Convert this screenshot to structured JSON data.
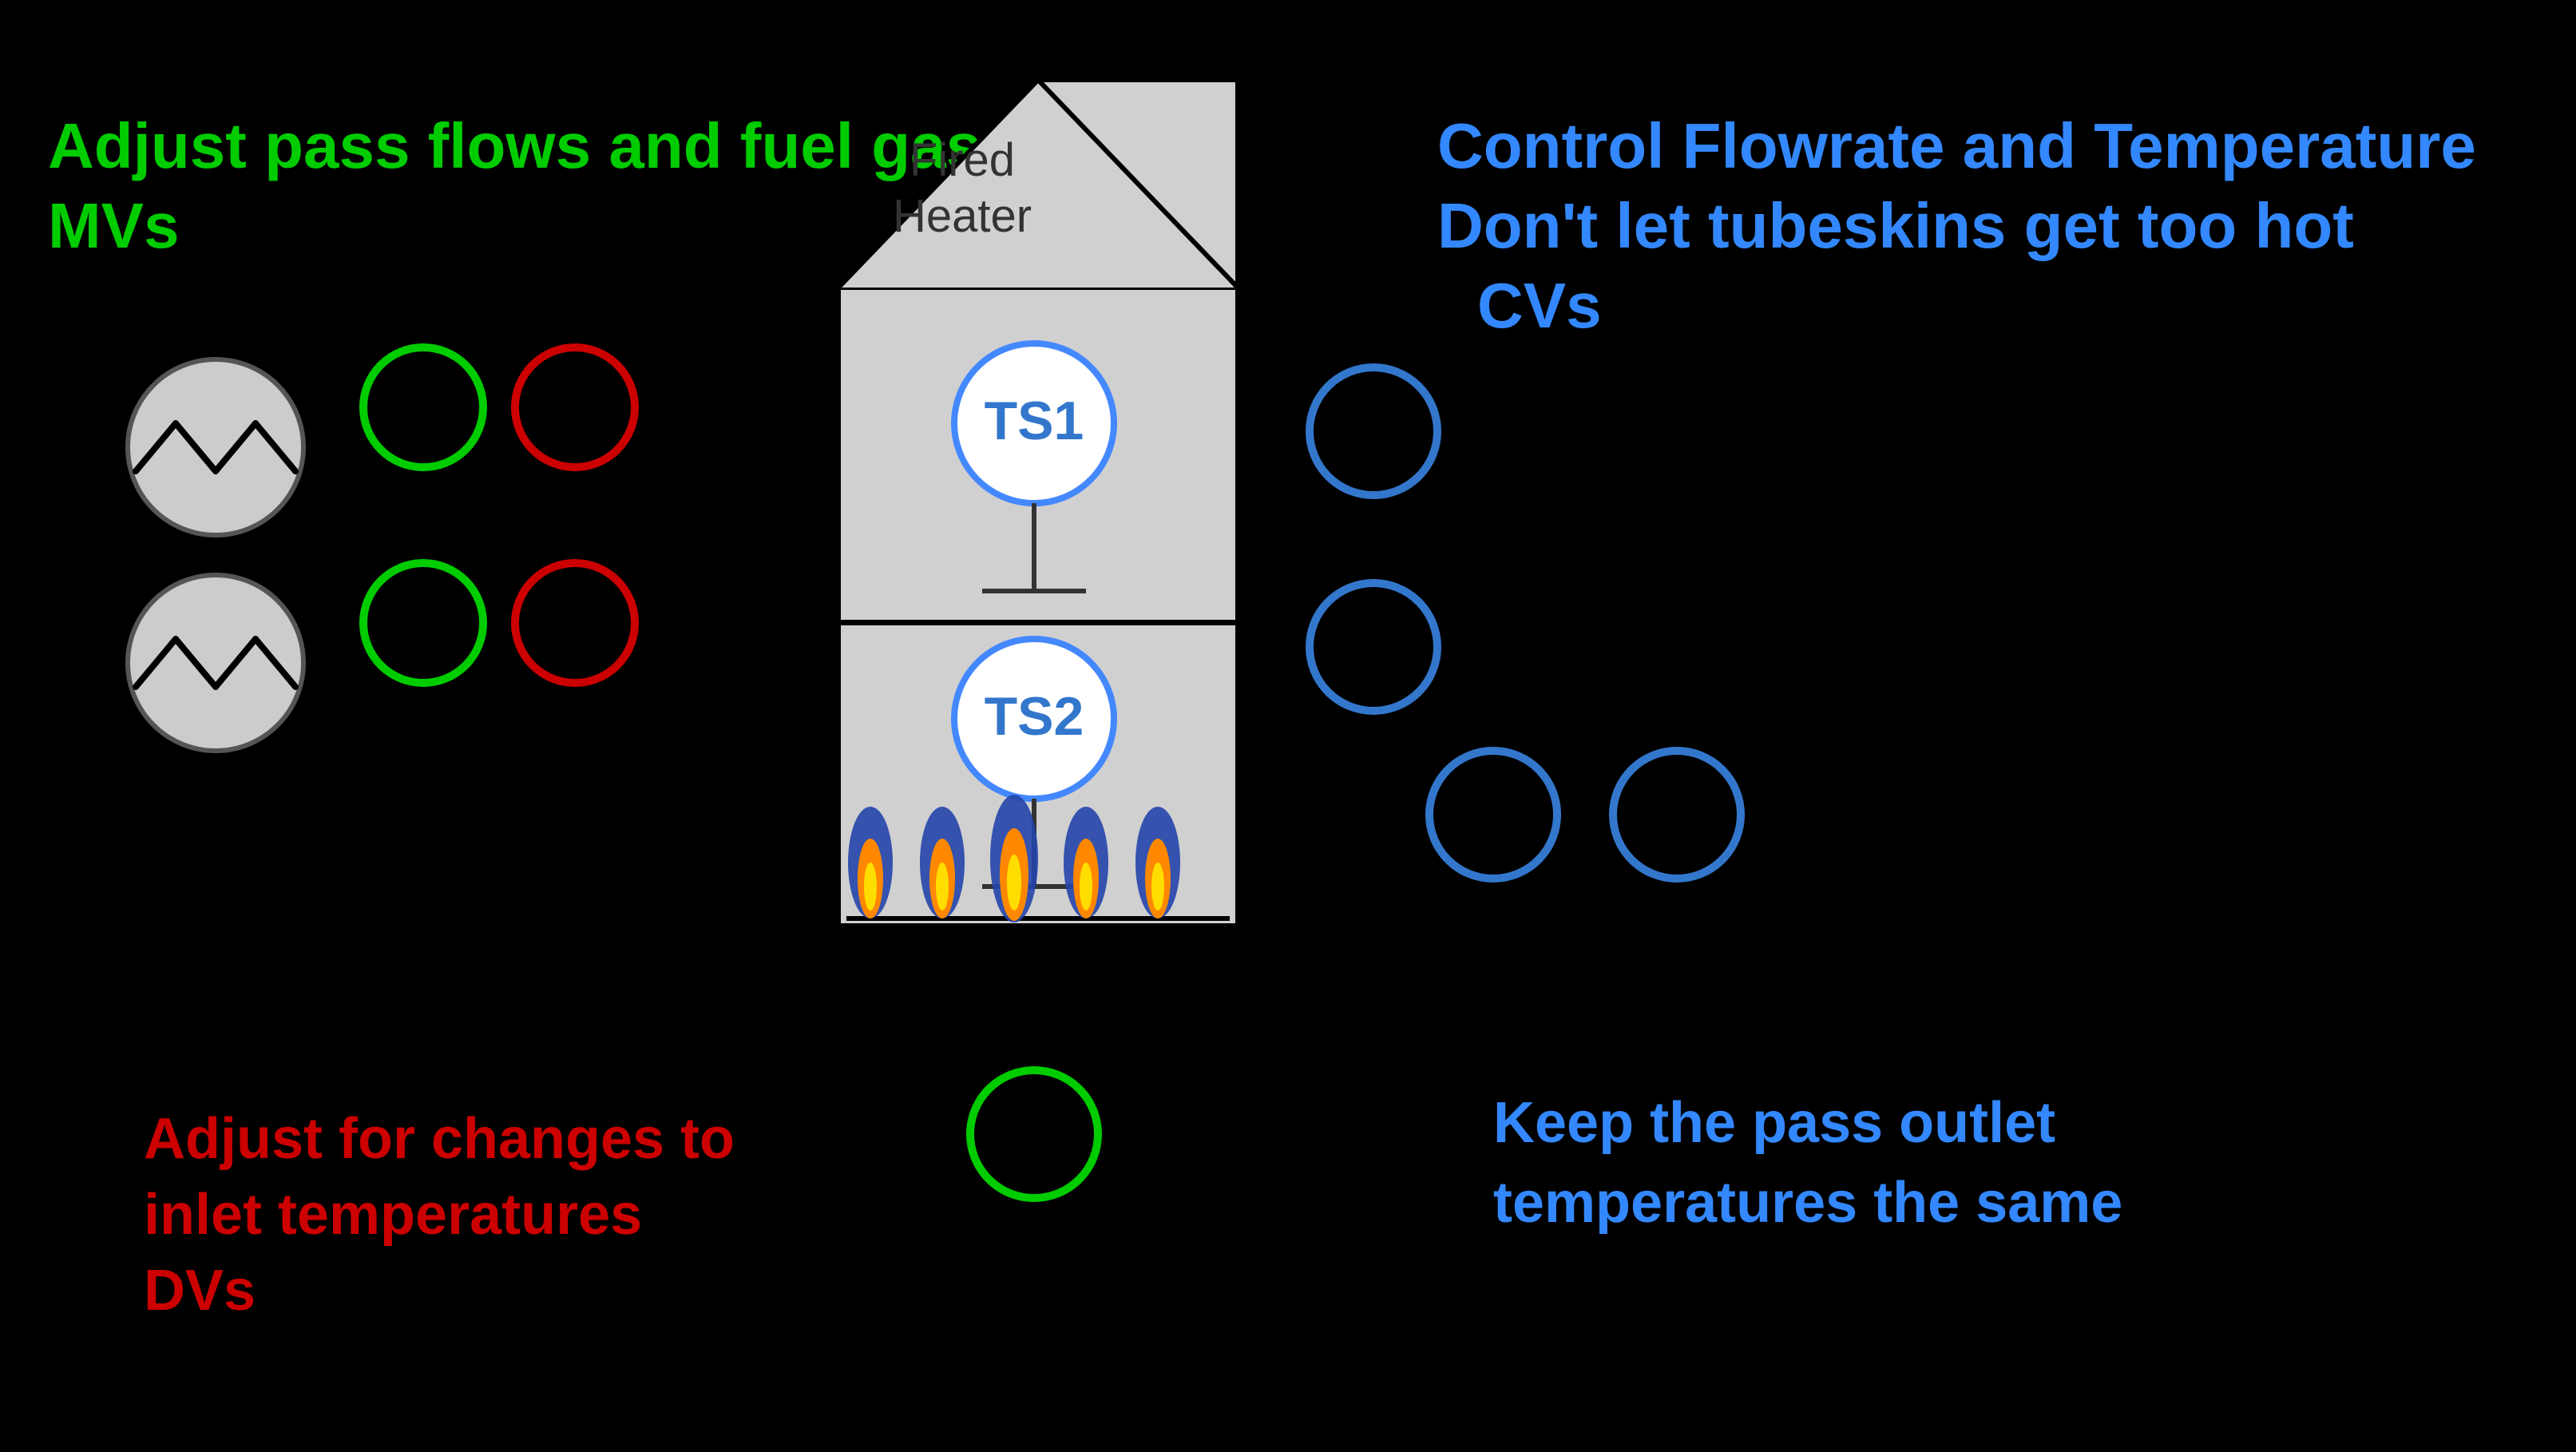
{
  "labels": {
    "mv_title": "Adjust pass flows and fuel gas",
    "mv_subtitle": "MVs",
    "cv_line1": "Control Flowrate and Temperature",
    "cv_line2": "Don't let tubeskins get too hot",
    "cv_subtitle": "CVs",
    "dv_line1": "Adjust for changes to",
    "dv_line2": "inlet temperatures",
    "dv_subtitle": "DVs",
    "pass_outlet_line1": "Keep the pass outlet",
    "pass_outlet_line2": "temperatures the same"
  },
  "colors": {
    "background": "#000000",
    "green": "#00cc00",
    "red": "#cc0000",
    "blue": "#3377cc",
    "heater_fill": "#d0d0d0",
    "heater_stroke": "#000000",
    "ts_circle_stroke": "#4488ff",
    "ts_circle_fill": "white",
    "flame_orange": "#ff8800",
    "flame_dark": "#cc4400",
    "burner_blue": "#2244aa"
  },
  "sensors": {
    "ts1_label": "TS1",
    "ts2_label": "TS2"
  },
  "heater": {
    "label_line1": "Fired",
    "label_line2": "Heater"
  }
}
